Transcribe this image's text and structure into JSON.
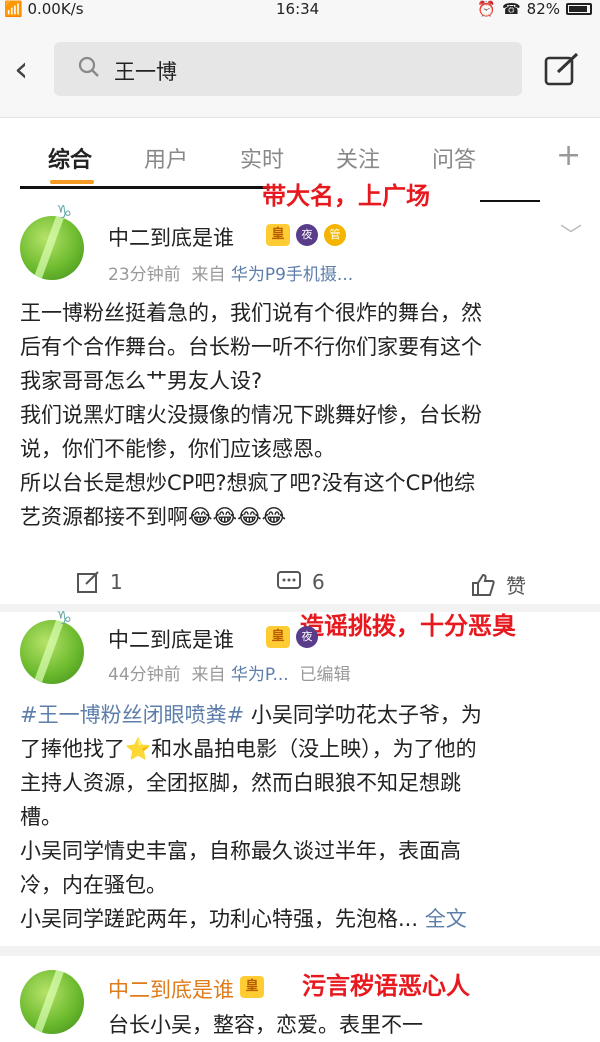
{
  "status_bar": {
    "network": "0.00K/s",
    "time": "16:34",
    "battery": "82%"
  },
  "search": {
    "query": "王一博"
  },
  "tabs": [
    "综合",
    "用户",
    "实时",
    "关注",
    "问答"
  ],
  "annotations": {
    "a1": "带大名，上广场",
    "a2": "造谣挑拨，十分恶臭",
    "a3": "污言秽语恶心人"
  },
  "posts": [
    {
      "username": "中二到底是谁",
      "badges": [
        "皇",
        "夜",
        "管"
      ],
      "time": "23分钟前",
      "source_prefix": "来自",
      "source": "华为P9手机摄...",
      "lines": [
        "王一博粉丝挺着急的，我们说有个很炸的舞台，然",
        "后有个合作舞台。台长粉一听不行你们家要有这个",
        "我家哥哥怎么艹男友人设?",
        "我们说黑灯瞎火没摄像的情况下跳舞好惨，台长粉",
        "说，你们不能惨，你们应该感恩。",
        "所以台长是想炒CP吧?想疯了吧?没有这个CP他综",
        "艺资源都接不到啊😂😂😂😂"
      ],
      "reposts": "1",
      "comments": "6",
      "likes": "赞"
    },
    {
      "username": "中二到底是谁",
      "time": "44分钟前",
      "source_prefix": "来自",
      "source": "华为P...",
      "edited": "已编辑",
      "topic": "#王一博粉丝闭眼喷粪#",
      "lines": [
        " 小吴同学叻花太子爷，为",
        "了捧他找了⭐和水晶拍电影（没上映），为了他的",
        "主持人资源，全团抠脚，然而白眼狼不知足想跳",
        "槽。",
        "小吴同学情史丰富，自称最久谈过半年，表面高",
        "冷，内在骚包。",
        "小吴同学蹉跎两年，功利心特强，先泡格..."
      ],
      "full_text": "全文"
    },
    {
      "username": "中二到底是谁",
      "line": "台长小吴，整容，恋爱。表里不一"
    }
  ]
}
